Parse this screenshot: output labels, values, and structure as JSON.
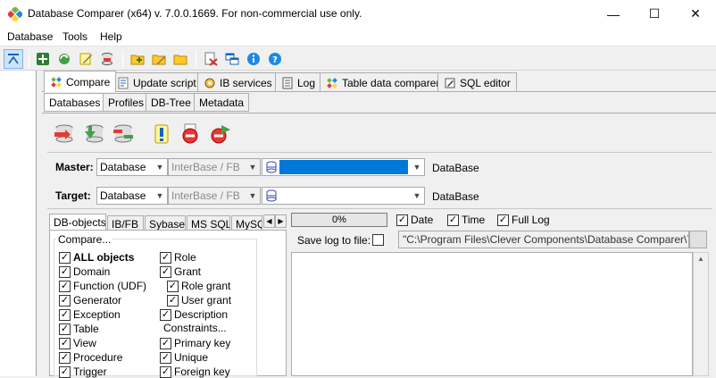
{
  "window": {
    "title": "Database Comparer (x64) v. 7.0.0.1669. For non-commercial use only.",
    "minimize_glyph": "—",
    "maximize_glyph": "☐",
    "close_glyph": "✕"
  },
  "menu": {
    "items": [
      "Database",
      "Tools",
      "Help"
    ]
  },
  "main_tabs": [
    "Compare",
    "Update script",
    "IB services",
    "Log",
    "Table data comparer",
    "SQL editor"
  ],
  "sub_tabs": [
    "Databases",
    "Profiles",
    "DB-Tree",
    "Metadata"
  ],
  "master": {
    "label": "Master:",
    "db_type": "Database",
    "server_type": "InterBase / FB",
    "path": "",
    "suffix": "DataBase"
  },
  "target": {
    "label": "Target:",
    "db_type": "Database",
    "server_type": "InterBase / FB",
    "path": "",
    "suffix": "DataBase"
  },
  "options_tabs": [
    "DB-objects",
    "IB/FB",
    "Sybase.",
    "MS SQL",
    "MySQ"
  ],
  "compare_group": "Compare...",
  "objects_col1": [
    "ALL objects",
    "Domain",
    "Function (UDF)",
    "Generator",
    "Exception",
    "Table",
    "View",
    "Procedure",
    "Trigger"
  ],
  "objects_col2": [
    {
      "label": "Role",
      "indent": false
    },
    {
      "label": "Grant",
      "indent": false
    },
    {
      "label": "Role grant",
      "indent": true
    },
    {
      "label": "User grant",
      "indent": true
    },
    {
      "label": "Description",
      "indent": false
    }
  ],
  "constraints_label": "Constraints...",
  "constraints": [
    "Primary key",
    "Unique",
    "Foreign key"
  ],
  "progress": {
    "text": "0%",
    "value": 0
  },
  "log_options": [
    "Date",
    "Time",
    "Full Log"
  ],
  "save_log": {
    "label": "Save log to file:",
    "path": "\"C:\\Program Files\\Clever Components\\Database Comparer\\Tools\\"
  },
  "colors": {
    "selection": "#0078d7",
    "accent_active": "#0078d7"
  }
}
